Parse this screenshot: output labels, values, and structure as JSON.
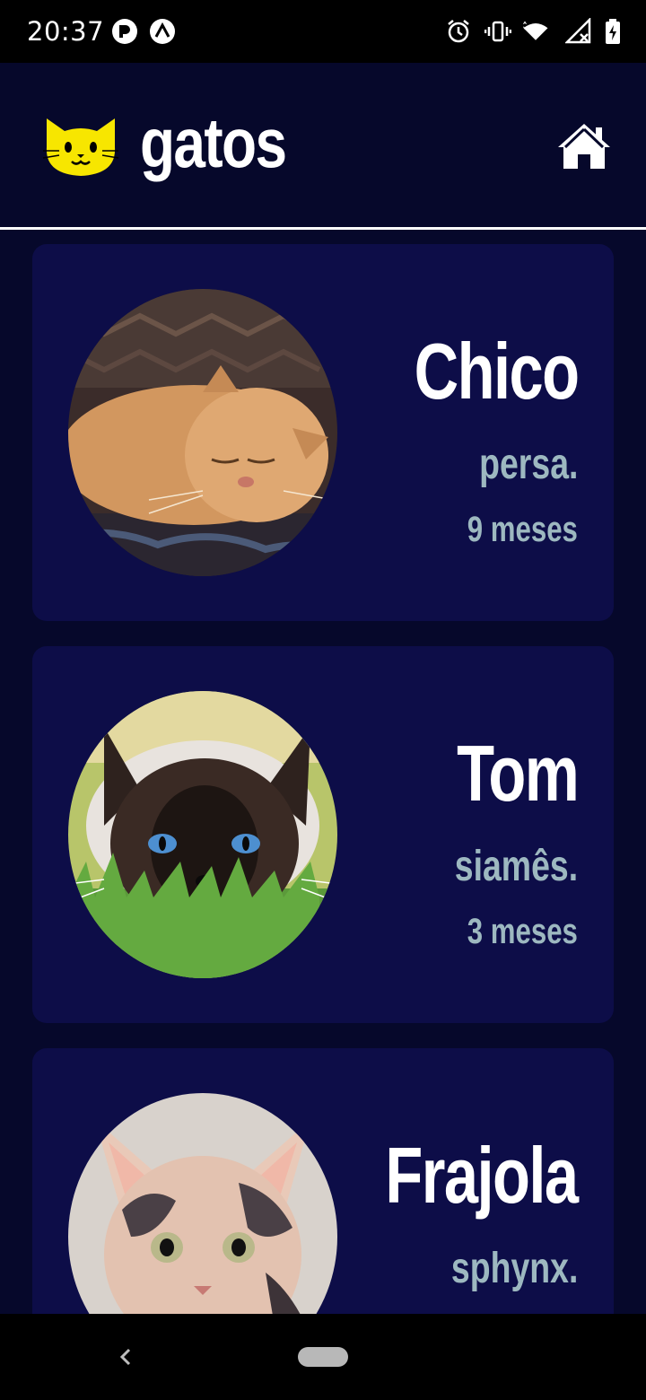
{
  "status_bar": {
    "time": "20:37",
    "icons_left": [
      "notification-icon",
      "app-notification-icon"
    ],
    "icons_right": [
      "alarm-icon",
      "vibrate-icon",
      "wifi-icon",
      "signal-icon",
      "battery-icon"
    ]
  },
  "header": {
    "logo_icon": "cat-face-icon",
    "title": "gatos",
    "home_icon": "home-icon"
  },
  "cats": [
    {
      "name": "Chico",
      "breed": "persa.",
      "age": "9 meses"
    },
    {
      "name": "Tom",
      "breed": "siamês.",
      "age": "3 meses"
    },
    {
      "name": "Frajola",
      "breed": "sphynx.",
      "age": ""
    }
  ],
  "nav": {
    "back_icon": "back-chevron-icon",
    "home_pill": "home-pill"
  },
  "colors": {
    "background": "#06082b",
    "card": "#0d0d48",
    "text_primary": "#ffffff",
    "text_secondary": "#9db8c0",
    "logo": "#f7e600"
  }
}
